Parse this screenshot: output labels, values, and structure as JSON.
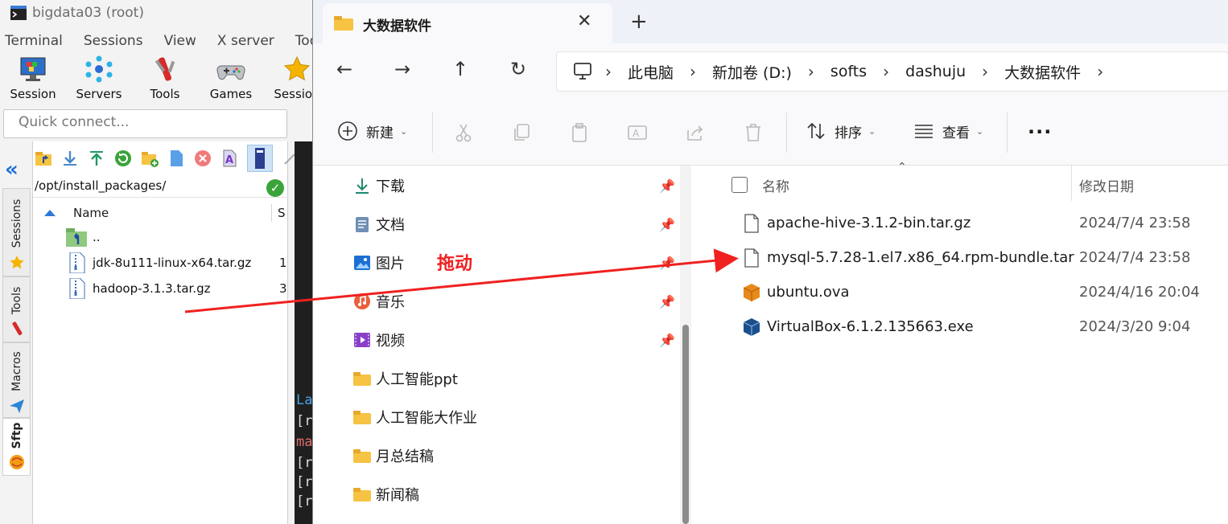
{
  "moba": {
    "title": "bigdata03 (root)",
    "menu": [
      "Terminal",
      "Sessions",
      "View",
      "X server",
      "Tool"
    ],
    "toolbar": [
      {
        "label": "Session",
        "icon": "monitor-icon"
      },
      {
        "label": "Servers",
        "icon": "servers-icon"
      },
      {
        "label": "Tools",
        "icon": "tools-icon"
      },
      {
        "label": "Games",
        "icon": "gamepad-icon"
      },
      {
        "label": "Session",
        "icon": "star-icon"
      }
    ],
    "quick_connect_placeholder": "Quick connect...",
    "side_tabs": [
      "Sessions",
      "Tools",
      "Macros",
      "Sftp"
    ],
    "sftp": {
      "path": "/opt/install_packages/",
      "col_name": "Name",
      "col_size": "S",
      "rows": [
        {
          "name": "..",
          "size": "",
          "icon": "parent-folder-icon"
        },
        {
          "name": "jdk-8u111-linux-x64.tar.gz",
          "size": "1",
          "icon": "archive-file-icon"
        },
        {
          "name": "hadoop-3.1.3.tar.gz",
          "size": "3",
          "icon": "archive-file-icon"
        }
      ]
    },
    "terminal_fragments": [
      "La",
      "[r",
      "ma",
      "[r",
      "[r",
      "[r"
    ]
  },
  "explorer": {
    "tab_title": "大数据软件",
    "breadcrumb": [
      "此电脑",
      "新加卷 (D:)",
      "softs",
      "dashuju",
      "大数据软件"
    ],
    "commands": {
      "new": "新建",
      "sort": "排序",
      "view": "查看",
      "more": "..."
    },
    "nav_items": [
      {
        "label": "下载",
        "icon": "download-icon",
        "pinned": true
      },
      {
        "label": "文档",
        "icon": "document-icon",
        "pinned": true
      },
      {
        "label": "图片",
        "icon": "pictures-icon",
        "pinned": true
      },
      {
        "label": "音乐",
        "icon": "music-icon",
        "pinned": true
      },
      {
        "label": "视频",
        "icon": "video-icon",
        "pinned": true
      },
      {
        "label": "人工智能ppt",
        "icon": "folder-icon",
        "pinned": false
      },
      {
        "label": "人工智能大作业",
        "icon": "folder-icon",
        "pinned": false
      },
      {
        "label": "月总结稿",
        "icon": "folder-icon",
        "pinned": false
      },
      {
        "label": "新闻稿",
        "icon": "folder-icon",
        "pinned": false
      }
    ],
    "list_header": {
      "name": "名称",
      "date": "修改日期"
    },
    "files": [
      {
        "name": "apache-hive-3.1.2-bin.tar.gz",
        "date": "2024/7/4 23:58",
        "icon": "file-icon"
      },
      {
        "name": "mysql-5.7.28-1.el7.x86_64.rpm-bundle.tar",
        "date": "2024/7/4 23:58",
        "icon": "file-icon"
      },
      {
        "name": "ubuntu.ova",
        "date": "2024/4/16 20:04",
        "icon": "virtualbox-ova-icon"
      },
      {
        "name": "VirtualBox-6.1.2.135663.exe",
        "date": "2024/3/20 9:04",
        "icon": "virtualbox-exe-icon"
      }
    ]
  },
  "annotation": {
    "label": "拖动",
    "color": "#f02020"
  }
}
